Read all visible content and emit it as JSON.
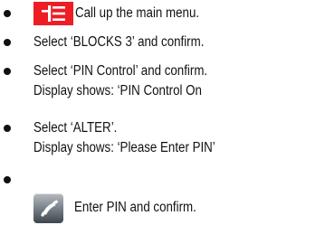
{
  "instructions": {
    "step1": "Call up the main menu.",
    "step2": "Select ‘BLOCKS 3’ and confirm.",
    "step3_line1": "Select ‘PIN Control’ and confirm.",
    "step3_line2": "Display shows: ‘PIN Control On",
    "step4_line1": "Select ‘ALTER’.",
    "step4_line2": "Display shows: ‘Please Enter PIN’",
    "step5": "Enter PIN and confirm."
  },
  "icons": {
    "menu_key": "menu-key-icon",
    "call_key": "handset-key-icon"
  },
  "colors": {
    "menu_key_background": "#ee1c25",
    "text": "#111111"
  }
}
